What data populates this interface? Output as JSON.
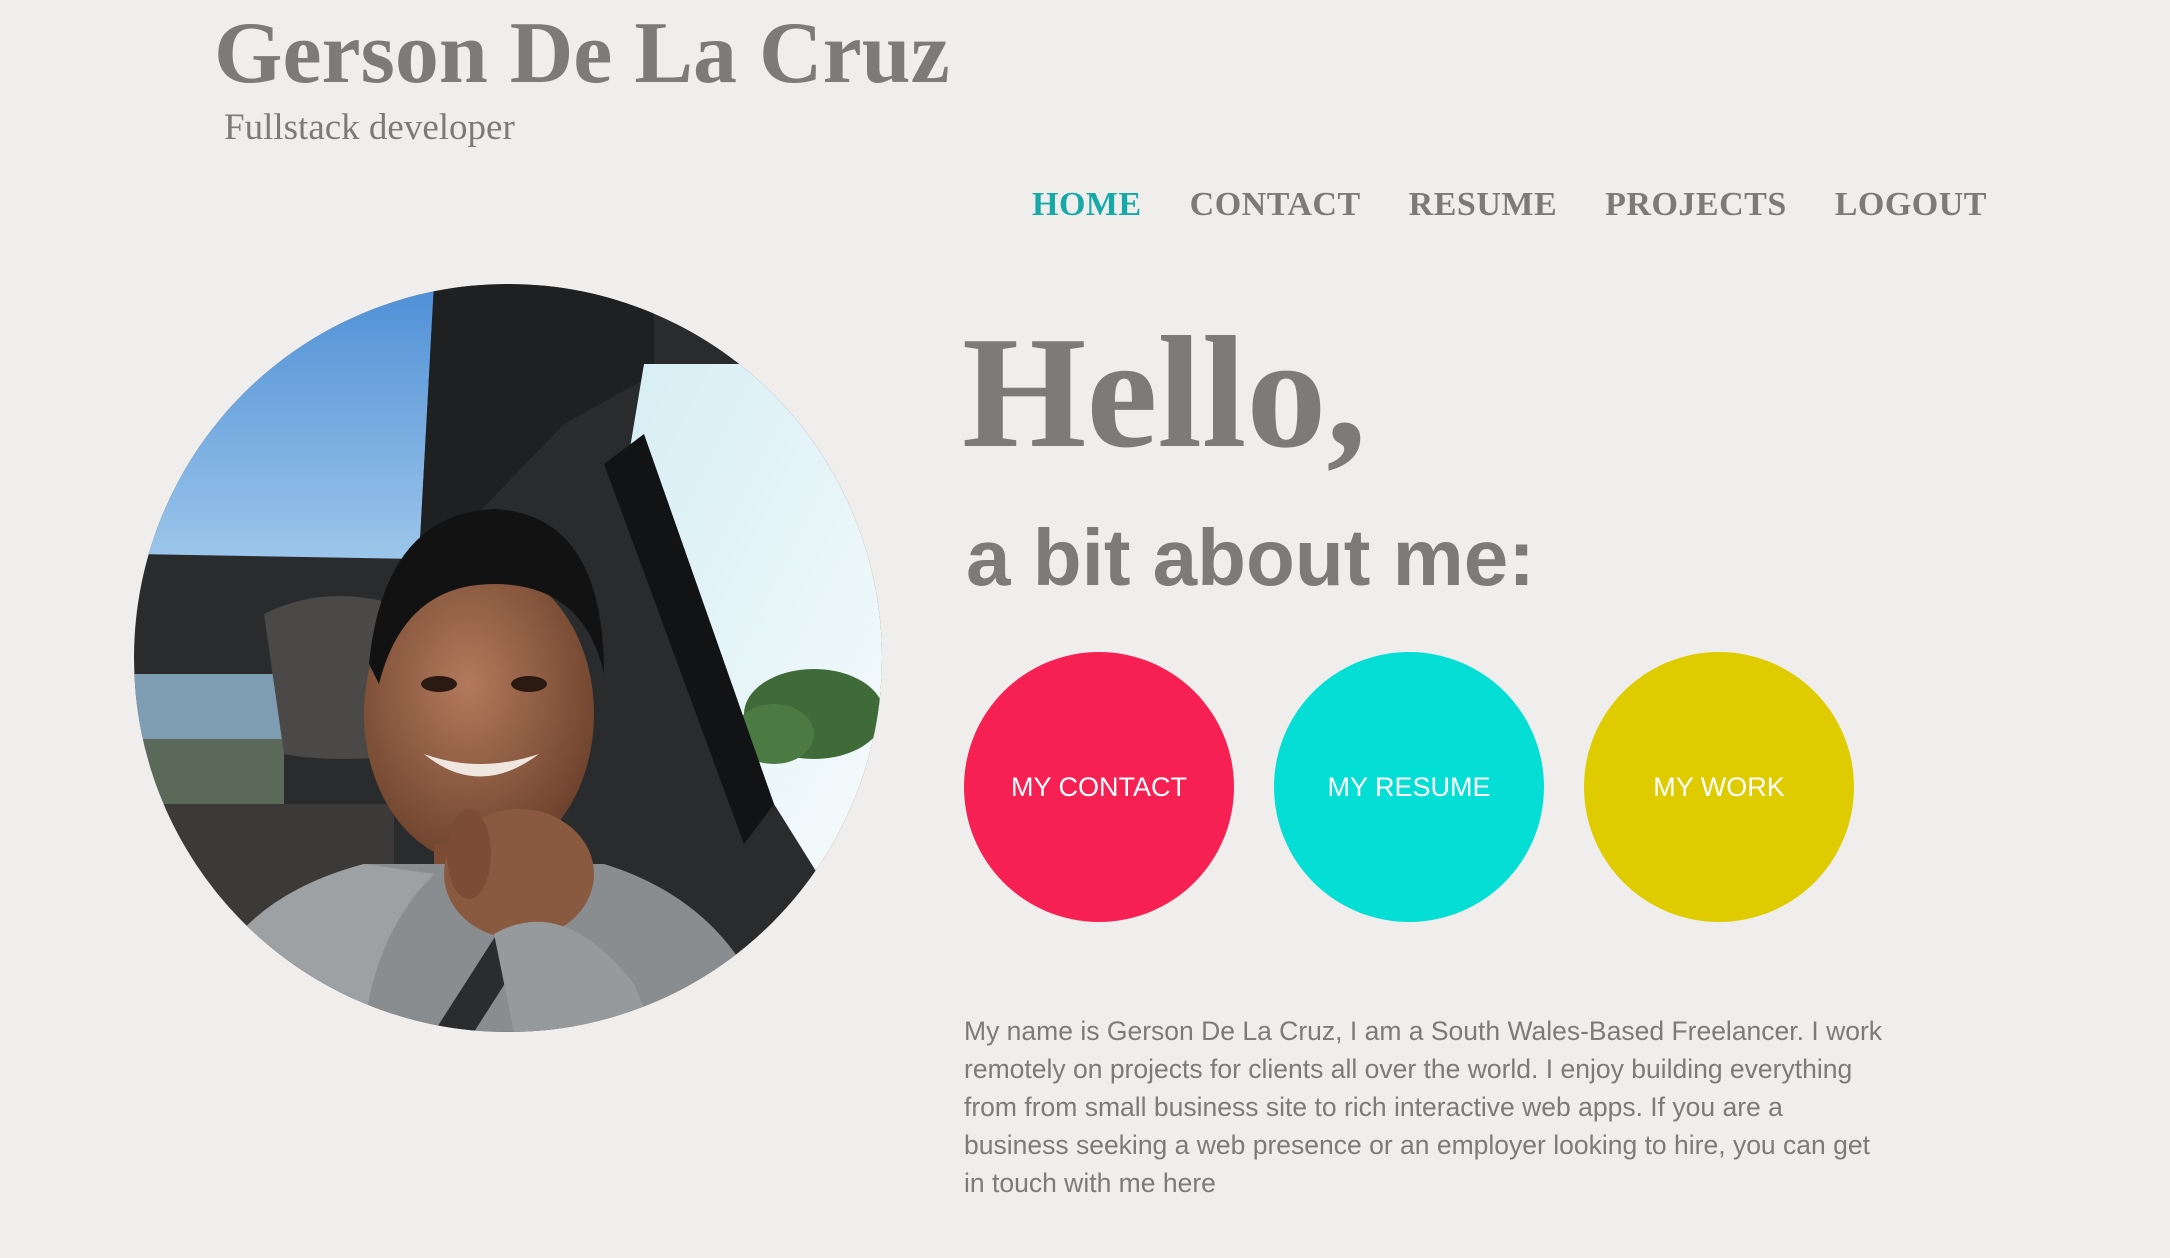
{
  "header": {
    "title": "Gerson De La Cruz",
    "subtitle": "Fullstack developer"
  },
  "nav": {
    "items": [
      {
        "label": "HOME",
        "active": true
      },
      {
        "label": "CONTACT",
        "active": false
      },
      {
        "label": "RESUME",
        "active": false
      },
      {
        "label": "PROJECTS",
        "active": false
      },
      {
        "label": "LOGOUT",
        "active": false
      }
    ],
    "active_color": "#17a9a8",
    "color": "#7d7b7a"
  },
  "main": {
    "hello": "Hello,",
    "about": "a bit about me:",
    "buttons": [
      {
        "label": "MY CONTACT",
        "color": "#f62152"
      },
      {
        "label": "MY RESUME",
        "color": "#05ded5"
      },
      {
        "label": "MY WORK",
        "color": "#dfcc00"
      }
    ],
    "bio": "My name is Gerson De La Cruz, I am a South Wales-Based Freelancer. I work remotely on projects for clients all over the world. I enjoy building everything from from small business site to rich interactive web apps. If you are a business seeking a web presence or an employer looking to hire, you can get in touch with me here"
  },
  "colors": {
    "background": "#efeeed",
    "text": "#7d7b7a"
  },
  "profile_photo": {
    "icon": "profile-photo"
  }
}
